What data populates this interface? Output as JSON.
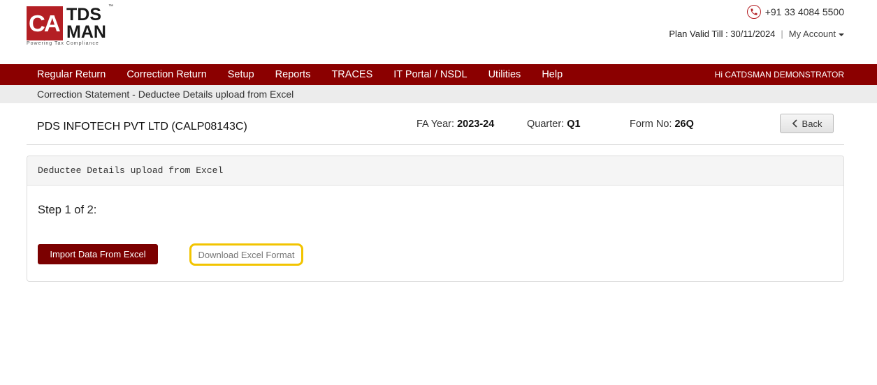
{
  "brand": {
    "logo_mark": "CA",
    "logo_line1": "TDS",
    "logo_line2": "MAN",
    "trademark": "™",
    "tagline": "Powering Tax Compliance"
  },
  "header": {
    "phone": "+91 33 4084 5500",
    "plan_valid": "Plan Valid Till : 30/11/2024",
    "separator": "|",
    "my_account": "My Account"
  },
  "nav": {
    "items": [
      "Regular Return",
      "Correction Return",
      "Setup",
      "Reports",
      "TRACES",
      "IT Portal / NSDL",
      "Utilities",
      "Help"
    ],
    "user": "Hi CATDSMAN DEMONSTRATOR"
  },
  "breadcrumb": "Correction Statement - Deductee Details upload from Excel",
  "info": {
    "company": "PDS INFOTECH PVT LTD (CALP08143C)",
    "fa_year_label": "FA Year:",
    "fa_year": "2023-24",
    "quarter_label": "Quarter:",
    "quarter": "Q1",
    "form_label": "Form No:",
    "form_no": "26Q",
    "back_label": "Back"
  },
  "panel": {
    "title": "Deductee Details upload from Excel",
    "step": "Step 1 of 2:",
    "import_label": "Import Data From Excel",
    "download_label": "Download Excel Format"
  },
  "colors": {
    "nav_bg": "#8b0000",
    "brand_red": "#b41f24",
    "highlight": "#f2c400"
  },
  "icons": [
    "phone-icon",
    "caret-down-icon",
    "chevron-left-icon"
  ]
}
